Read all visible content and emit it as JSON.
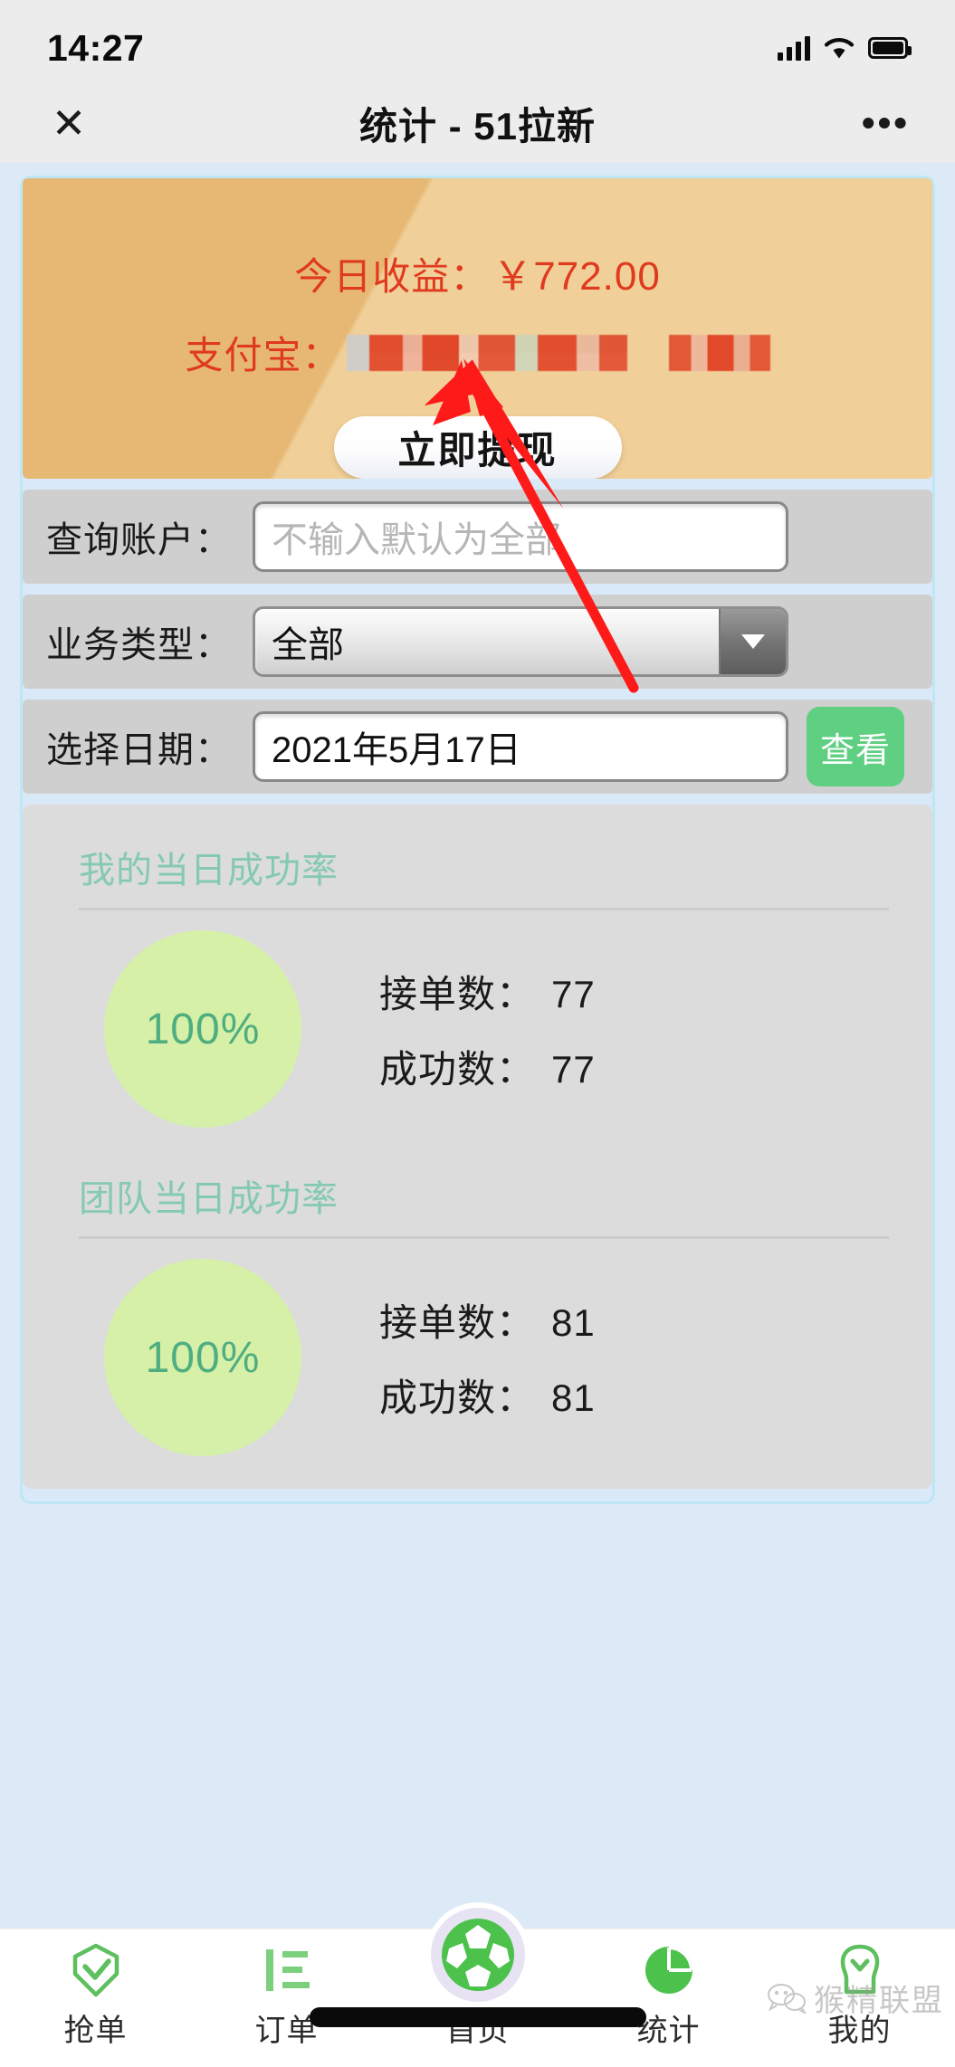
{
  "status_bar": {
    "time": "14:27",
    "signal_icon": "cellular-signal-icon",
    "wifi_icon": "wifi-icon",
    "battery_icon": "battery-full-icon"
  },
  "header": {
    "close_icon": "close-icon",
    "title": "统计 - 51拉新",
    "more_icon": "more-options-icon"
  },
  "income_card": {
    "income_label": "今日收益：",
    "income_amount": "￥772.00",
    "alipay_label": "支付宝：",
    "alipay_value_redacted": "",
    "withdraw_label": "立即提现",
    "accent_color": "#e03a1e",
    "card_color": "#e6b873"
  },
  "filters": {
    "account": {
      "label": "查询账户：",
      "value": "",
      "placeholder": "不输入默认为全部"
    },
    "business_type": {
      "label": "业务类型：",
      "value": "全部",
      "options": [
        "全部"
      ],
      "dropdown_icon": "chevron-down-icon"
    },
    "date": {
      "label": "选择日期：",
      "value": "2021年5月17日"
    },
    "view_button_label": "查看",
    "view_button_color": "#5fcf82"
  },
  "stats": [
    {
      "title": "我的当日成功率",
      "percent": "100%",
      "orders_label": "接单数：",
      "orders_value": "77",
      "success_label": "成功数：",
      "success_value": "77"
    },
    {
      "title": "团队当日成功率",
      "percent": "100%",
      "orders_label": "接单数：",
      "orders_value": "81",
      "success_label": "成功数：",
      "success_value": "81"
    }
  ],
  "tabbar": {
    "items": [
      {
        "label": "抢单",
        "icon": "grab-order-icon"
      },
      {
        "label": "订单",
        "icon": "order-list-icon"
      },
      {
        "label": "首页",
        "icon": "home-ball-icon"
      },
      {
        "label": "统计",
        "icon": "pie-chart-icon"
      },
      {
        "label": "我的",
        "icon": "profile-icon"
      }
    ],
    "active_color": "#4cbf4c"
  },
  "watermark": {
    "text": "猴精联盟",
    "icon": "wechat-icon"
  },
  "annotation": {
    "arrow_color": "#ff1a1a",
    "points_to": "alipay-account-value"
  }
}
